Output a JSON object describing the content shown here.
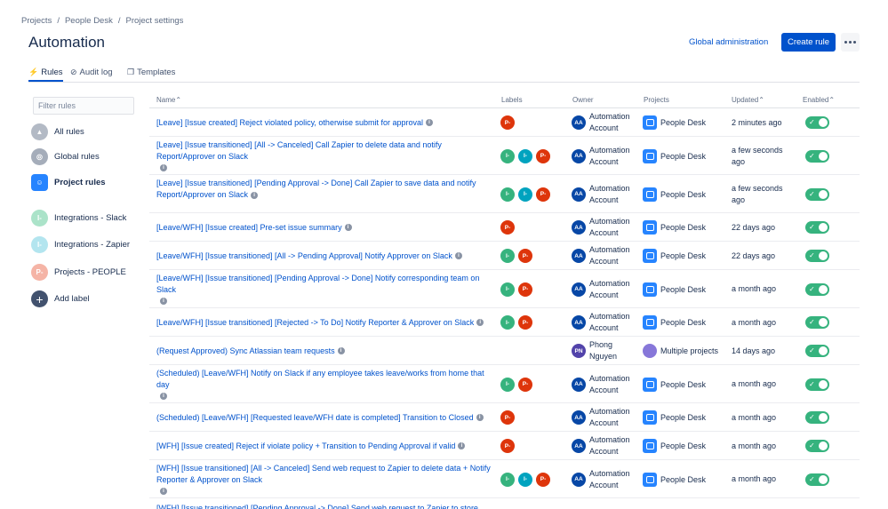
{
  "breadcrumb": [
    "Projects",
    "People Desk",
    "Project settings"
  ],
  "page_title": "Automation",
  "header": {
    "global_admin": "Global administration",
    "create_rule": "Create rule"
  },
  "tabs": [
    {
      "label": "Rules",
      "icon": "lightning-icon"
    },
    {
      "label": "Audit log",
      "icon": "check-circle-icon"
    },
    {
      "label": "Templates",
      "icon": "template-icon"
    }
  ],
  "filter": {
    "placeholder": "Filter rules",
    "value": ""
  },
  "sidebar": {
    "items": [
      {
        "label": "All rules",
        "icon": "all-rules-icon"
      },
      {
        "label": "Global rules",
        "icon": "global-rules-icon"
      },
      {
        "label": "Project rules",
        "icon": "project-icon"
      },
      {
        "label": "Integrations - Slack",
        "icon": "label-avatar",
        "initial": "I-"
      },
      {
        "label": "Integrations - Zapier",
        "icon": "label-avatar",
        "initial": "I-"
      },
      {
        "label": "Projects - PEOPLE",
        "icon": "label-avatar",
        "initial": "P-"
      },
      {
        "label": "Add label",
        "icon": "plus-icon"
      }
    ]
  },
  "columns": {
    "name": "Name",
    "labels": "Labels",
    "owner": "Owner",
    "projects": "Projects",
    "updated": "Updated",
    "enabled": "Enabled"
  },
  "colors": {
    "accent": "#0052cc",
    "toggle_on": "#36b37e",
    "label_slack": "#36b37e",
    "label_zapier": "#00a3bf",
    "label_people": "#de350b"
  },
  "rules": [
    {
      "name": "[Leave] [Issue created] Reject violated policy, otherwise submit for approval",
      "labels": [
        "P-"
      ],
      "owner_initials": "AA",
      "owner": "Automation Account",
      "project": "People Desk",
      "updated": "2 minutes ago",
      "enabled": true
    },
    {
      "name": "[Leave] [Issue transitioned] [All -> Canceled] Call Zapier to delete data and notify Report/Approver on Slack",
      "labels": [
        "I-",
        "I-",
        "P-"
      ],
      "owner_initials": "AA",
      "owner": "Automation Account",
      "project": "People Desk",
      "updated": "a few seconds ago",
      "enabled": true
    },
    {
      "name": "[Leave] [Issue transitioned] [Pending Approval -> Done] Call Zapier to save data and notify Report/Approver on Slack",
      "labels": [
        "I-",
        "I-",
        "P-"
      ],
      "owner_initials": "AA",
      "owner": "Automation Account",
      "project": "People Desk",
      "updated": "a few seconds ago",
      "enabled": true
    },
    {
      "name": "[Leave/WFH] [Issue created] Pre-set issue summary",
      "labels": [
        "P-"
      ],
      "owner_initials": "AA",
      "owner": "Automation Account",
      "project": "People Desk",
      "updated": "22 days ago",
      "enabled": true
    },
    {
      "name": "[Leave/WFH] [Issue transitioned] [All -> Pending Approval] Notify Approver on Slack",
      "labels": [
        "I-",
        "P-"
      ],
      "owner_initials": "AA",
      "owner": "Automation Account",
      "project": "People Desk",
      "updated": "22 days ago",
      "enabled": true
    },
    {
      "name": "[Leave/WFH] [Issue transitioned] [Pending Approval -> Done] Notify corresponding team on Slack",
      "labels": [
        "I-",
        "P-"
      ],
      "owner_initials": "AA",
      "owner": "Automation Account",
      "project": "People Desk",
      "updated": "a month ago",
      "enabled": true
    },
    {
      "name": "[Leave/WFH] [Issue transitioned] [Rejected -> To Do] Notify Reporter & Approver on Slack",
      "labels": [
        "I-",
        "P-"
      ],
      "owner_initials": "AA",
      "owner": "Automation Account",
      "project": "People Desk",
      "updated": "a month ago",
      "enabled": true
    },
    {
      "name": "(Request Approved) Sync Atlassian team requests",
      "labels": [],
      "owner_initials": "PN",
      "owner": "Phong Nguyen",
      "project": "Multiple projects",
      "updated": "14 days ago",
      "enabled": true
    },
    {
      "name": "(Scheduled) [Leave/WFH] Notify on Slack if any employee takes leave/works from home that day",
      "labels": [
        "I-",
        "P-"
      ],
      "owner_initials": "AA",
      "owner": "Automation Account",
      "project": "People Desk",
      "updated": "a month ago",
      "enabled": true
    },
    {
      "name": "(Scheduled) [Leave/WFH] [Requested leave/WFH date is completed] Transition to Closed",
      "labels": [
        "P-"
      ],
      "owner_initials": "AA",
      "owner": "Automation Account",
      "project": "People Desk",
      "updated": "a month ago",
      "enabled": true
    },
    {
      "name": "[WFH] [Issue created] Reject if violate policy + Transition to Pending Approval if valid",
      "labels": [
        "P-"
      ],
      "owner_initials": "AA",
      "owner": "Automation Account",
      "project": "People Desk",
      "updated": "a month ago",
      "enabled": true
    },
    {
      "name": "[WFH] [Issue transitioned] [All -> Canceled] Send web request to Zapier to delete data + Notify Reporter & Approver on Slack",
      "labels": [
        "I-",
        "I-",
        "P-"
      ],
      "owner_initials": "AA",
      "owner": "Automation Account",
      "project": "People Desk",
      "updated": "a month ago",
      "enabled": true
    },
    {
      "name": "[WFH] [Issue transitioned] [Pending Approval -> Done] Send web request to Zapier to store",
      "labels": [],
      "owner_initials": "",
      "owner": "",
      "project": "",
      "updated": "",
      "enabled": true
    }
  ]
}
